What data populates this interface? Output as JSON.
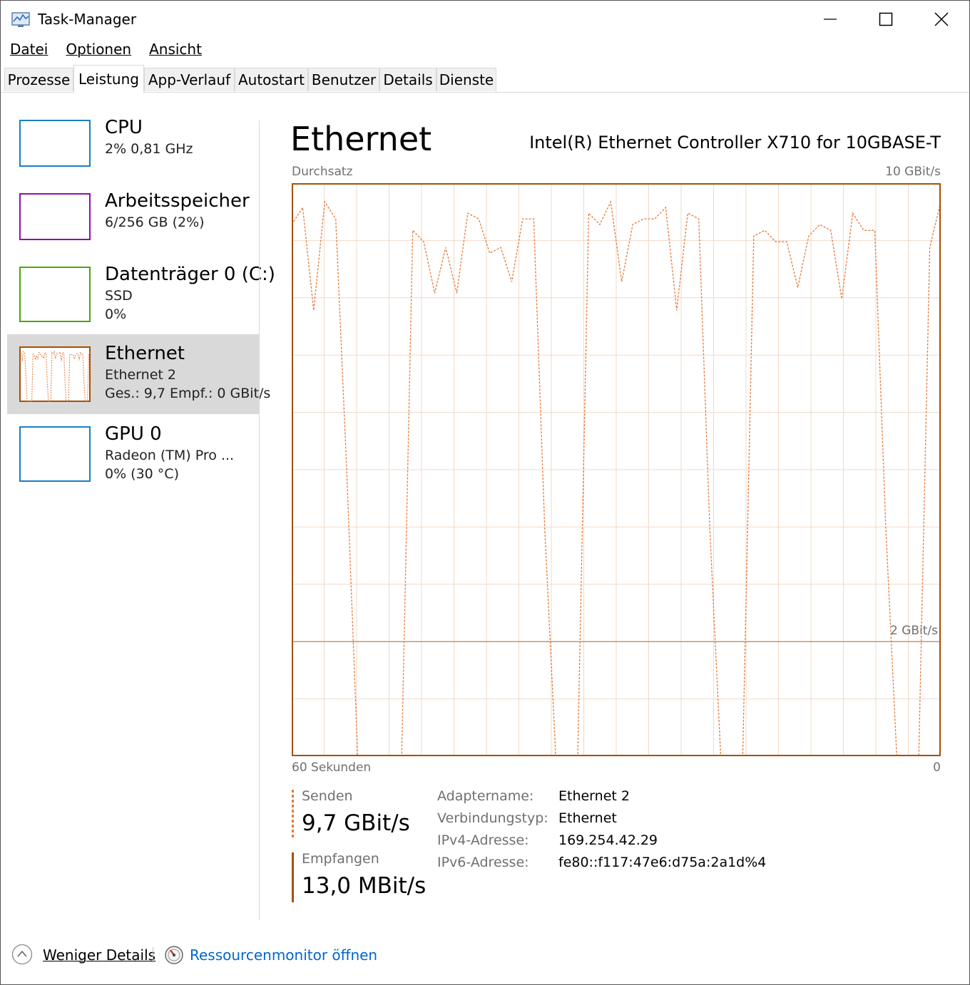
{
  "window": {
    "title": "Task-Manager"
  },
  "menu": [
    "Datei",
    "Optionen",
    "Ansicht"
  ],
  "tabs": [
    "Prozesse",
    "Leistung",
    "App-Verlauf",
    "Autostart",
    "Benutzer",
    "Details",
    "Dienste"
  ],
  "active_tab": "Leistung",
  "sidebar": [
    {
      "title": "CPU",
      "lines": [
        "2% 0,81 GHz"
      ],
      "color": "#1a7fc1"
    },
    {
      "title": "Arbeitsspeicher",
      "lines": [
        "6/256 GB (2%)"
      ],
      "color": "#8b12ae"
    },
    {
      "title": "Datenträger 0 (C:)",
      "lines": [
        "SSD",
        "0%"
      ],
      "color": "#4da60c"
    },
    {
      "title": "Ethernet",
      "lines": [
        "Ethernet 2",
        "Ges.: 9,7 Empf.: 0 GBit/s"
      ],
      "color": "#a74f01",
      "selected": true
    },
    {
      "title": "GPU 0",
      "lines": [
        "Radeon (TM) Pro ...",
        "0% (30 °C)"
      ],
      "color": "#1a7fc1"
    }
  ],
  "main": {
    "title": "Ethernet",
    "device": "Intel(R) Ethernet Controller X710 for 10GBASE-T",
    "graph_label": "Durchsatz",
    "graph_max_label": "10 GBit/s",
    "graph_mid_label": "2 GBit/s",
    "time_left_label": "60 Sekunden",
    "time_right_label": "0"
  },
  "stats": {
    "send_label": "Senden",
    "send_value": "9,7 GBit/s",
    "recv_label": "Empfangen",
    "recv_value": "13,0 MBit/s"
  },
  "properties": [
    {
      "key": "Adaptername:",
      "value": "Ethernet 2"
    },
    {
      "key": "Verbindungstyp:",
      "value": "Ethernet"
    },
    {
      "key": "IPv4-Adresse:",
      "value": "169.254.42.29"
    },
    {
      "key": "IPv6-Adresse:",
      "value": "fe80::f117:47e6:d75a:2a1d%4"
    }
  ],
  "footer": {
    "less_details": "Weniger Details",
    "resource_monitor": "Ressourcenmonitor öffnen"
  },
  "colors": {
    "ethernet": "#a74f01",
    "send_line": "#e47a3c",
    "grid": "#f1d9c7",
    "link": "#0066cc"
  },
  "chart_data": {
    "type": "line",
    "y_unit": "GBit/s",
    "ylim": [
      0,
      10
    ],
    "x_span_seconds": 60,
    "series": [
      {
        "name": "Senden",
        "values": [
          9.3,
          9.6,
          7.8,
          9.7,
          9.4,
          5.0,
          0.0,
          0.0,
          0.0,
          0.0,
          0.0,
          9.2,
          9.0,
          8.1,
          8.9,
          8.1,
          9.5,
          9.4,
          8.8,
          8.9,
          8.3,
          9.4,
          9.4,
          4.0,
          0.0,
          0.0,
          0.0,
          9.5,
          9.3,
          9.7,
          8.3,
          9.3,
          9.4,
          9.4,
          9.6,
          7.8,
          9.5,
          9.4,
          4.0,
          0.0,
          0.0,
          0.0,
          9.1,
          9.2,
          9.0,
          9.0,
          8.2,
          9.1,
          9.3,
          9.2,
          8.0,
          9.5,
          9.2,
          9.2,
          4.0,
          0.0,
          0.0,
          0.0,
          8.9,
          9.7
        ]
      }
    ]
  }
}
